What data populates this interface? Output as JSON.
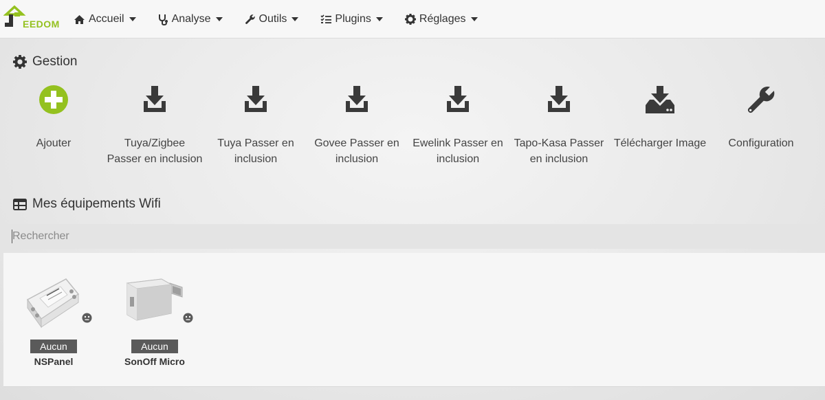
{
  "app": {
    "logo_text": "EEDOM"
  },
  "nav": [
    {
      "label": "Accueil",
      "icon": "home-icon"
    },
    {
      "label": "Analyse",
      "icon": "stethoscope-icon"
    },
    {
      "label": "Outils",
      "icon": "wrench-icon"
    },
    {
      "label": "Plugins",
      "icon": "tasks-icon"
    },
    {
      "label": "Réglages",
      "icon": "gear-icon"
    }
  ],
  "gestion": {
    "title": "Gestion",
    "actions": [
      {
        "label": "Ajouter",
        "icon": "plus-circle-icon",
        "color": "#94c11f"
      },
      {
        "label": "Tuya/Zigbee Passer en inclusion",
        "icon": "download-icon"
      },
      {
        "label": "Tuya Passer en inclusion",
        "icon": "download-icon"
      },
      {
        "label": "Govee Passer en inclusion",
        "icon": "download-icon"
      },
      {
        "label": "Ewelink Passer en inclusion",
        "icon": "download-icon"
      },
      {
        "label": "Tapo-Kasa Passer en inclusion",
        "icon": "download-icon"
      },
      {
        "label": "Télécharger Image",
        "icon": "hdd-download-icon"
      },
      {
        "label": "Configuration",
        "icon": "wrench-icon"
      }
    ]
  },
  "equipment": {
    "title": "Mes équipements Wifi",
    "search_placeholder": "Rechercher",
    "items": [
      {
        "name": "NSPanel",
        "badge": "Aucun",
        "image": "sonoff-basic-module",
        "status_icon": "neutral-face-icon"
      },
      {
        "name": "SonOff Micro",
        "badge": "Aucun",
        "image": "sonoff-micro-usb-adapter",
        "status_icon": "neutral-face-icon"
      }
    ]
  },
  "colors": {
    "accent": "#94c11f",
    "icon": "#3a3a3a",
    "badge": "#5a5a5a"
  }
}
